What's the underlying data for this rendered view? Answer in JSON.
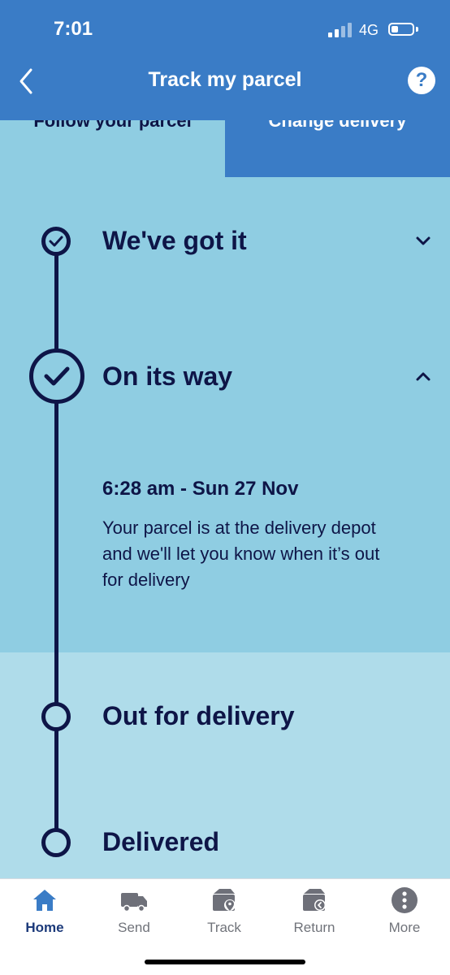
{
  "status_bar": {
    "time": "7:01",
    "network": "4G"
  },
  "header": {
    "title": "Track my parcel",
    "help_label": "?"
  },
  "tabs": [
    {
      "label": "Follow your parcel",
      "active": true
    },
    {
      "label": "Change delivery",
      "active": false
    }
  ],
  "timeline": {
    "steps": [
      {
        "title": "We've got it",
        "status": "done",
        "expanded": false
      },
      {
        "title": "On its way",
        "status": "done",
        "expanded": true
      },
      {
        "title": "Out for delivery",
        "status": "pending"
      },
      {
        "title": "Delivered",
        "status": "pending"
      }
    ],
    "event": {
      "time": "6:28 am - Sun 27 Nov",
      "description": "Your parcel is at the delivery depot and we'll let you know when it’s out for delivery"
    }
  },
  "bottom_nav": {
    "items": [
      {
        "label": "Home",
        "icon": "home-icon",
        "active": true
      },
      {
        "label": "Send",
        "icon": "van-icon"
      },
      {
        "label": "Track",
        "icon": "track-parcel-icon"
      },
      {
        "label": "Return",
        "icon": "return-parcel-icon"
      },
      {
        "label": "More",
        "icon": "more-icon"
      }
    ]
  },
  "colors": {
    "header_blue": "#3a7cc6",
    "content_blue": "#8fcde2",
    "lower_blue": "#afdcea",
    "navy": "#0e1547"
  }
}
